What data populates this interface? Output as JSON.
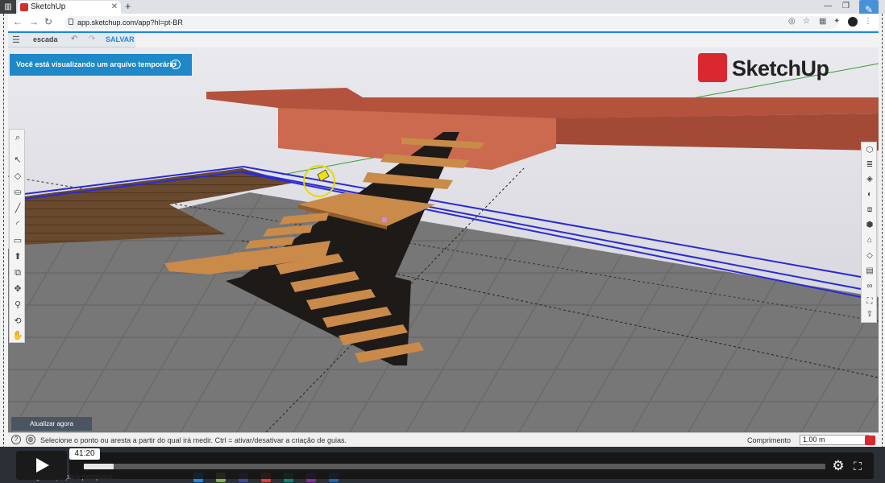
{
  "browser": {
    "tab_title": "SketchUp",
    "url": "app.sketchup.com/app?hl=pt-BR",
    "new_tab_label": "+"
  },
  "app": {
    "file_name": "escada",
    "save_label": "SALVAR",
    "temp_file_notice": "Você está visualizando um arquivo temporário",
    "logo_text": "SketchUp",
    "update_button": "Atualizar agora",
    "status_message": "Selecione o ponto ou aresta a partir do qual irá medir. Ctrl = ativar/desativar a criação de guias.",
    "length_label": "Comprimento",
    "length_value": "1.00 m",
    "left_tools": [
      "search-icon",
      "select-icon",
      "eraser-icon",
      "paint-bucket-icon",
      "line-icon",
      "arc-icon",
      "rectangle-icon",
      "push-pull-icon",
      "offset-icon",
      "move-icon",
      "tape-measure-icon",
      "orbit-icon",
      "pan-icon"
    ],
    "right_tools": [
      "entity-info-icon",
      "layers-icon",
      "materials-icon",
      "styles-icon",
      "components-icon",
      "scenes-icon",
      "outliner-icon",
      "tags-icon",
      "display-icon",
      "glasses-icon",
      "instructor-icon",
      "export-icon"
    ]
  },
  "player": {
    "time": "41:20",
    "progress": 0.04
  },
  "taskbar": {
    "search_placeholder": "Digite aqui para pesquisar"
  },
  "colors": {
    "accent": "#1e88e5",
    "logo_red": "#d9282f",
    "banner": "#1e88c8",
    "wood": "#c98a4a",
    "slab": "#a24a36"
  }
}
